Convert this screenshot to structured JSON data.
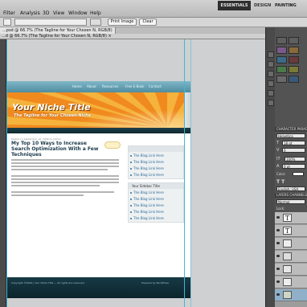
{
  "menubar": {
    "items": [
      "Filter",
      "Analysis",
      "3D",
      "View",
      "Window",
      "Help"
    ],
    "workspaces": {
      "active": "ESSENTIALS",
      "design": "DESIGN",
      "painting": "PAINTING",
      "more": "»"
    }
  },
  "options": {
    "print_image": "Print Image",
    "clear": "Clear"
  },
  "document": {
    "tab1": "...psd @ 66.7% (The Tagline for Your Chosen N, RGB/8)",
    "tab2": "...d @ 66.7% (The Tagline for Your Chosen N, RGB/8) ×"
  },
  "webpage": {
    "nav": [
      "Home",
      "About",
      "Resources",
      "Free E-Book",
      "Contact"
    ],
    "site_title": "Your Niche Title",
    "tagline": "The Tagline for Your Chosen Niche",
    "post_meta": "Posted on September 19, 2009 by Admin",
    "post_title": "My Top 10 Ways to Increase Search Optimization With a Few Techniques",
    "sidebar1_links": [
      "The Blog Link Here",
      "The Blog Link Here",
      "The Blog Link Here",
      "The Blog Link Here"
    ],
    "sidebar2_heading": "Your Sidebar Title",
    "sidebar2_links": [
      "The Blog Link Here",
      "The Blog Link Here",
      "The Blog Link Here",
      "The Blog Link Here",
      "The Blog Link Here"
    ],
    "footer_left": "Copyright ©2009 | Your Niche Title — All rights are reserved.",
    "footer_right": "Powered by WordPress"
  },
  "panels": {
    "character_tabs": "CHARACTER   PARAGRAPH",
    "font_family": "Helvetica",
    "font_size": "18 pt",
    "leading": "0",
    "tracking": "100%",
    "baseline": "0 pt",
    "color_label": "Color:",
    "language": "English: USA",
    "layers_tabs": "LAYERS   CHANNELS",
    "blend_mode": "Normal",
    "lock_label": "Lock:"
  },
  "colors": {
    "accent_guides": "#3fb8d6",
    "banner_orange": "#f3a42a",
    "nav_teal": "#5a98aa",
    "footer_dark": "#12313b",
    "link_blue": "#2a6a9a"
  }
}
